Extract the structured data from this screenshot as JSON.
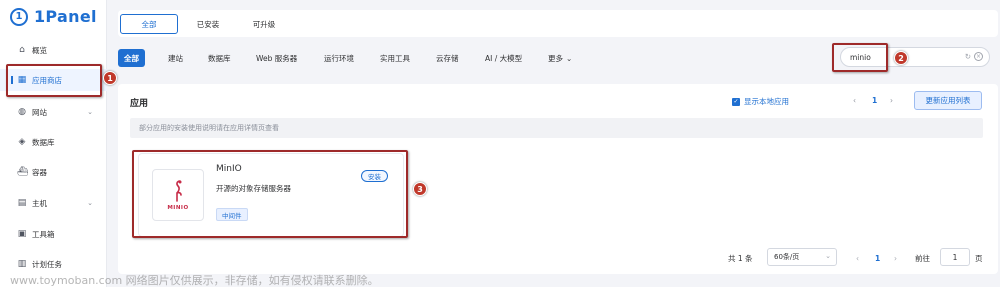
{
  "brand": {
    "logo_text": "1Panel"
  },
  "sidebar": {
    "items": [
      {
        "label": "概览",
        "icon": "home-icon"
      },
      {
        "label": "应用商店",
        "icon": "grid-icon"
      },
      {
        "label": "网站",
        "icon": "globe-icon"
      },
      {
        "label": "数据库",
        "icon": "database-icon"
      },
      {
        "label": "容器",
        "icon": "container-icon"
      },
      {
        "label": "主机",
        "icon": "host-icon"
      },
      {
        "label": "工具箱",
        "icon": "toolbox-icon"
      },
      {
        "label": "计划任务",
        "icon": "schedule-icon"
      }
    ]
  },
  "top_tabs": [
    "全部",
    "已安装",
    "可升级"
  ],
  "filters": [
    "全部",
    "建站",
    "数据库",
    "Web 服务器",
    "运行环境",
    "实用工具",
    "云存储",
    "AI / 大模型",
    "更多"
  ],
  "search": {
    "value": "minio"
  },
  "section": {
    "title": "应用",
    "show_local": "显示本地应用",
    "page_current": "1",
    "update_button": "更新应用列表",
    "notice": "部分应用的安装使用说明请在应用详情页查看"
  },
  "app_card": {
    "name": "MinIO",
    "description": "开源的对象存储服务器",
    "tag": "中间件",
    "install_label": "安装",
    "logo_word": "MINIO"
  },
  "pagination": {
    "total": "共 1 条",
    "page_size": "60条/页",
    "current": "1",
    "goto_label": "前往",
    "goto_value": "1",
    "goto_suffix": "页"
  },
  "annotations": [
    "1",
    "2",
    "3"
  ],
  "watermark": "www.toymoban.com 网络图片仅供展示，非存储，如有侵权请联系删除。",
  "colors": {
    "primary": "#1f6fd1",
    "annotation": "#9e2a2a",
    "minio_red": "#c72c48"
  }
}
